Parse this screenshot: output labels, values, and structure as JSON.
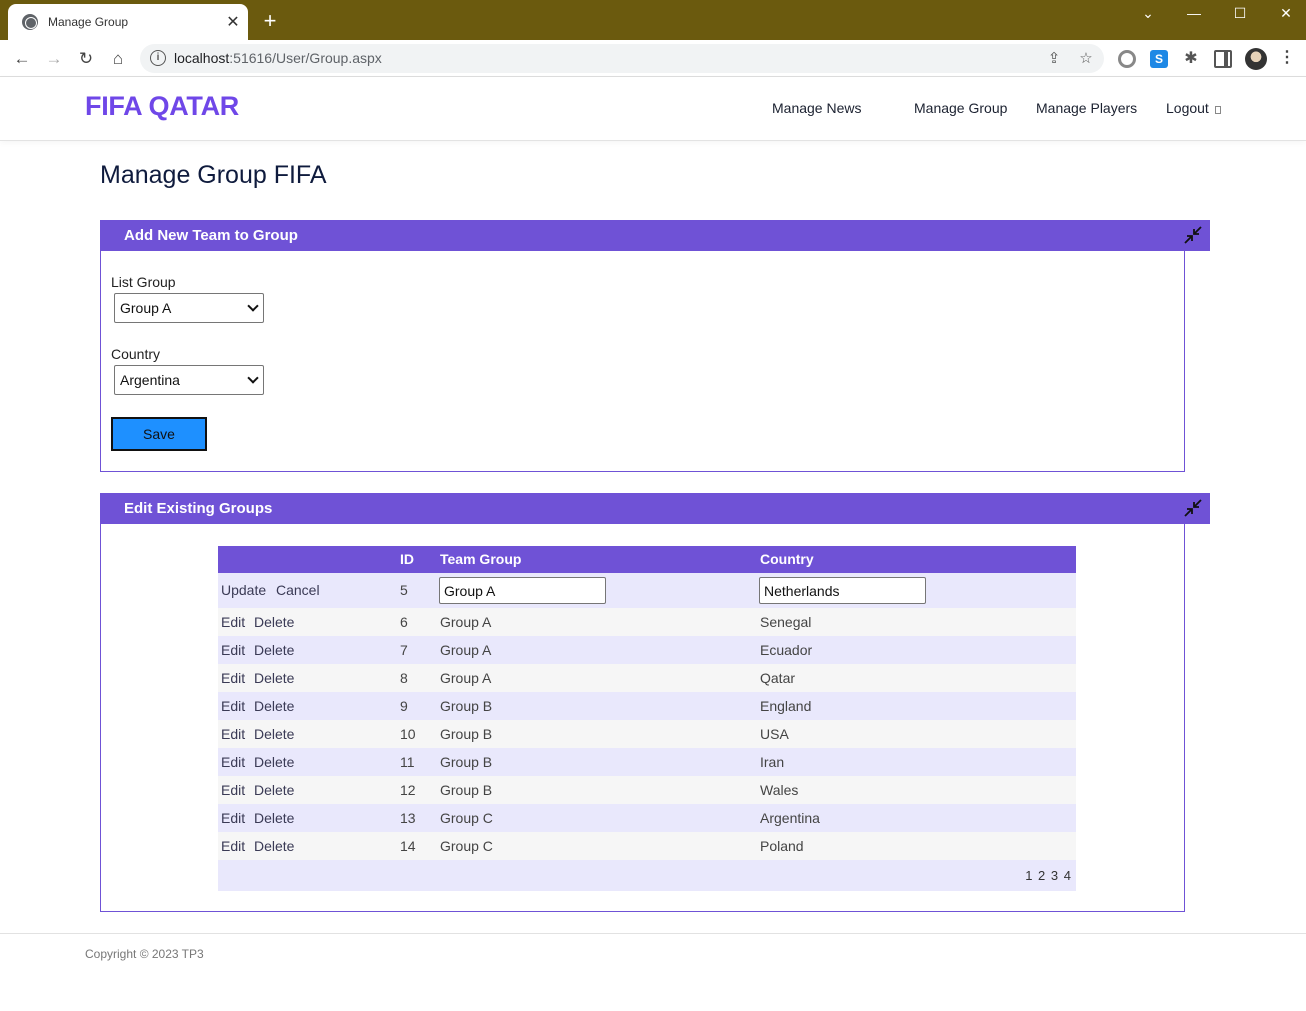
{
  "browser": {
    "tab_title": "Manage Group",
    "url_host": "localhost",
    "url_rest": ":51616/User/Group.aspx"
  },
  "site": {
    "brand": "FIFA QATAR",
    "nav": [
      "Manage News",
      "Manage Group",
      "Manage Players",
      "Logout"
    ]
  },
  "page": {
    "title": "Manage Group FIFA"
  },
  "add_panel": {
    "title": "Add New Team to Group",
    "group_label": "List Group",
    "group_value": "Group A",
    "country_label": "Country",
    "country_value": "Argentina",
    "save_label": "Save"
  },
  "edit_panel": {
    "title": "Edit Existing Groups",
    "columns": [
      "",
      "ID",
      "Team Group",
      "Country"
    ],
    "edit_row": {
      "update_label": "Update",
      "cancel_label": "Cancel",
      "id": "5",
      "group": "Group A",
      "country": "Netherlands"
    },
    "rows": [
      {
        "id": "6",
        "group": "Group A",
        "country": "Senegal"
      },
      {
        "id": "7",
        "group": "Group A",
        "country": "Ecuador"
      },
      {
        "id": "8",
        "group": "Group A",
        "country": "Qatar"
      },
      {
        "id": "9",
        "group": "Group B",
        "country": "England"
      },
      {
        "id": "10",
        "group": "Group B",
        "country": "USA"
      },
      {
        "id": "11",
        "group": "Group B",
        "country": "Iran"
      },
      {
        "id": "12",
        "group": "Group B",
        "country": "Wales"
      },
      {
        "id": "13",
        "group": "Group C",
        "country": "Argentina"
      },
      {
        "id": "14",
        "group": "Group C",
        "country": "Poland"
      }
    ],
    "edit_label": "Edit",
    "delete_label": "Delete",
    "pages": [
      "1",
      "2",
      "3",
      "4"
    ]
  },
  "footer": {
    "text": "Copyright © 2023 TP3"
  },
  "colors": {
    "brand": "#6f47e8",
    "panel_header": "#6f52d6",
    "save_button": "#1e90ff",
    "titlebar": "#6b5a0e"
  }
}
